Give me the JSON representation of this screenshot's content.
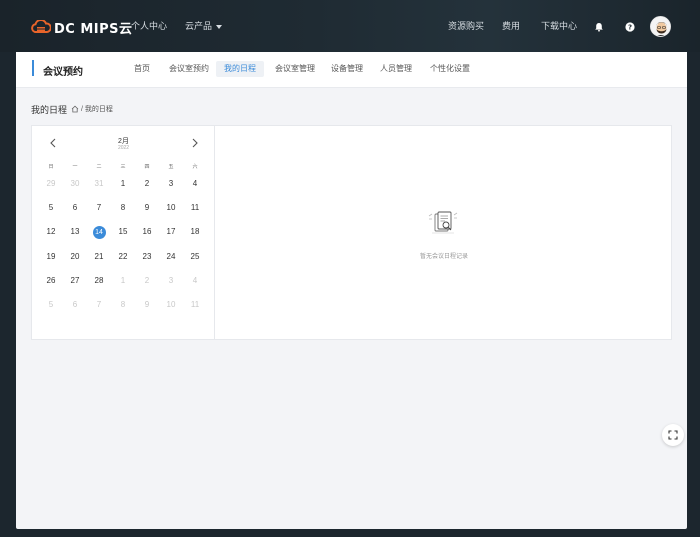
{
  "topnav": {
    "logo_text": "DC MIPS云",
    "personal_center": "个人中心",
    "cloud_products": "云产品",
    "resource_purchase": "资源购买",
    "fees": "费用",
    "download_center": "下载中心",
    "icons": [
      "bell-icon",
      "help-icon"
    ]
  },
  "subheader": {
    "title": "会议预约",
    "tabs": [
      {
        "label": "首页"
      },
      {
        "label": "会议室预约"
      },
      {
        "label": "我的日程",
        "active": true
      },
      {
        "label": "会议室管理"
      },
      {
        "label": "设备管理"
      },
      {
        "label": "人员管理"
      },
      {
        "label": "个性化设置"
      }
    ]
  },
  "page": {
    "title": "我的日程",
    "breadcrumb": "/ 我的日程"
  },
  "calendar": {
    "month": "2月",
    "year": "2022",
    "weekdays": [
      "日",
      "一",
      "二",
      "三",
      "四",
      "五",
      "六"
    ],
    "rows": [
      [
        {
          "d": "29",
          "m": true
        },
        {
          "d": "30",
          "m": true
        },
        {
          "d": "31",
          "m": true
        },
        {
          "d": "1"
        },
        {
          "d": "2"
        },
        {
          "d": "3"
        },
        {
          "d": "4"
        }
      ],
      [
        {
          "d": "5"
        },
        {
          "d": "6"
        },
        {
          "d": "7"
        },
        {
          "d": "8"
        },
        {
          "d": "9"
        },
        {
          "d": "10"
        },
        {
          "d": "11"
        }
      ],
      [
        {
          "d": "12"
        },
        {
          "d": "13"
        },
        {
          "d": "14",
          "today": true
        },
        {
          "d": "15"
        },
        {
          "d": "16"
        },
        {
          "d": "17"
        },
        {
          "d": "18"
        }
      ],
      [
        {
          "d": "19"
        },
        {
          "d": "20"
        },
        {
          "d": "21"
        },
        {
          "d": "22"
        },
        {
          "d": "23"
        },
        {
          "d": "24"
        },
        {
          "d": "25"
        }
      ],
      [
        {
          "d": "26"
        },
        {
          "d": "27"
        },
        {
          "d": "28"
        },
        {
          "d": "1",
          "m": true
        },
        {
          "d": "2",
          "m": true
        },
        {
          "d": "3",
          "m": true
        },
        {
          "d": "4",
          "m": true
        }
      ],
      [
        {
          "d": "5",
          "m": true
        },
        {
          "d": "6",
          "m": true
        },
        {
          "d": "7",
          "m": true
        },
        {
          "d": "8",
          "m": true
        },
        {
          "d": "9",
          "m": true
        },
        {
          "d": "10",
          "m": true
        },
        {
          "d": "11",
          "m": true
        }
      ]
    ]
  },
  "empty_state": {
    "text": "暂无会议日程记录"
  },
  "colors": {
    "accent": "#3b8bd9",
    "topbar": "#1c262e",
    "panel_bg": "#f3f4f7"
  }
}
